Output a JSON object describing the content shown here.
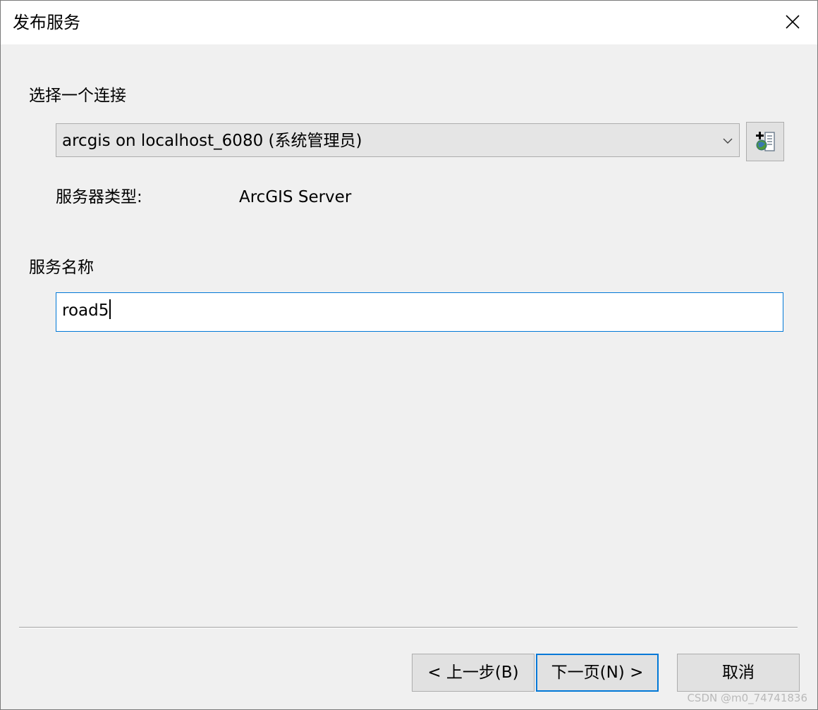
{
  "window": {
    "title": "发布服务"
  },
  "connection": {
    "section_label": "选择一个连接",
    "selected": "arcgis on localhost_6080 (系统管理员)",
    "server_type_label": "服务器类型:",
    "server_type_value": "ArcGIS Server"
  },
  "service": {
    "section_label": "服务名称",
    "name_value": "road5"
  },
  "footer": {
    "back_label": "< 上一步(B)",
    "next_label": "下一页(N) >",
    "cancel_label": "取消"
  },
  "watermark": "CSDN @m0_74741836",
  "icons": {
    "close": "close-icon",
    "dropdown": "chevron-down-icon",
    "add_connection": "add-server-connection-icon"
  },
  "colors": {
    "accent": "#0078d7",
    "dialog_bg": "#f0f0f0"
  }
}
